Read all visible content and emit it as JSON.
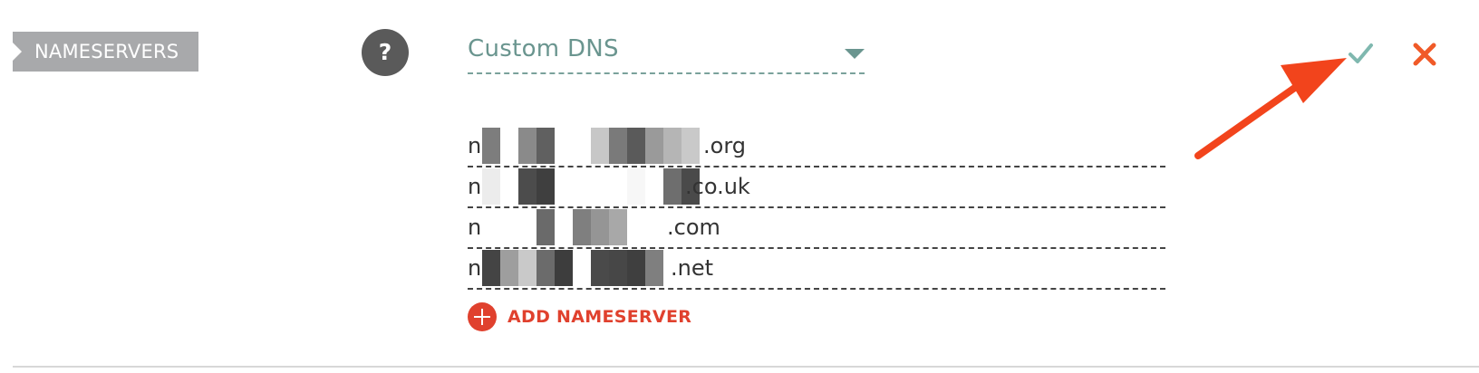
{
  "section": {
    "label": "NAMESERVERS"
  },
  "help": {
    "label": "?"
  },
  "dns_select": {
    "value": "Custom DNS"
  },
  "actions": {
    "confirm_icon": "checkmark-icon",
    "cancel_icon": "close-icon",
    "confirm_color": "#7fb8af",
    "cancel_color": "#f05a28"
  },
  "nameservers": [
    {
      "prefix": "n",
      "suffix": ".org"
    },
    {
      "prefix": "n",
      "suffix": ".co.uk"
    },
    {
      "prefix": "n",
      "suffix": ".com"
    },
    {
      "prefix": "n",
      "suffix": ".net"
    }
  ],
  "add_nameserver": {
    "label": "ADD NAMESERVER",
    "icon": "plus-circle-icon",
    "color": "#e0412e"
  },
  "annotation": {
    "color": "#f2441c"
  }
}
